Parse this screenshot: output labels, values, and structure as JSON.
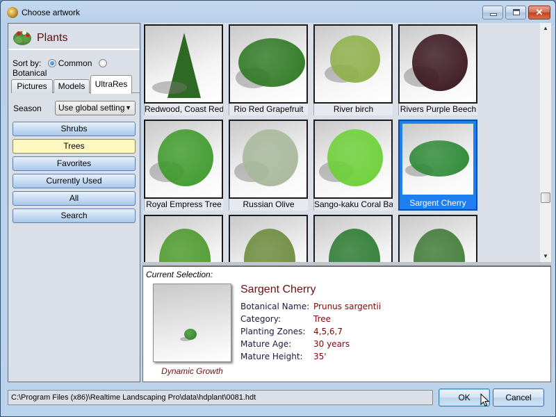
{
  "window": {
    "title": "Choose artwork",
    "controls": {
      "minimize": "minimize",
      "maximize": "maximize",
      "close": "✕"
    }
  },
  "sidebar": {
    "heading": "Plants",
    "sort_label": "Sort by:",
    "sort_options": [
      {
        "label": "Common",
        "selected": true
      },
      {
        "label": "Botanical",
        "selected": false
      }
    ],
    "tabs": [
      {
        "label": "Pictures",
        "active": false
      },
      {
        "label": "Models",
        "active": false
      },
      {
        "label": "UltraRes",
        "active": true
      }
    ],
    "season_label": "Season",
    "season_value": "Use global setting",
    "categories": [
      {
        "label": "Shrubs",
        "active": false
      },
      {
        "label": "Trees",
        "active": true
      },
      {
        "label": "Favorites",
        "active": false
      },
      {
        "label": "Currently Used",
        "active": false
      },
      {
        "label": "All",
        "active": false
      },
      {
        "label": "Search",
        "active": false
      }
    ]
  },
  "grid": {
    "items": [
      {
        "name": "Redwood, Coast Red...",
        "color": "#2f6a24",
        "shape": "cone",
        "selected": false
      },
      {
        "name": "Rio Red Grapefruit",
        "color": "#2f7a24",
        "shape": "bush",
        "selected": false
      },
      {
        "name": "River birch",
        "color": "#8fb04a",
        "shape": "airy",
        "selected": false
      },
      {
        "name": "Rivers Purple Beech",
        "color": "#3a1620",
        "shape": "round",
        "selected": false
      },
      {
        "name": "Royal Empress Tree",
        "color": "#3f9a2c",
        "shape": "round",
        "selected": false
      },
      {
        "name": "Russian Olive",
        "color": "#a8b89a",
        "shape": "round",
        "selected": false
      },
      {
        "name": "Sango-kaku Coral Ba...",
        "color": "#6cd035",
        "shape": "round",
        "selected": false
      },
      {
        "name": "Sargent Cherry",
        "color": "#2e8a36",
        "shape": "wide",
        "selected": true
      },
      {
        "name": "",
        "color": "#4a9a2a",
        "shape": "partial",
        "selected": false
      },
      {
        "name": "",
        "color": "#6a8a3a",
        "shape": "partial",
        "selected": false
      },
      {
        "name": "",
        "color": "#2a7a30",
        "shape": "partial",
        "selected": false
      },
      {
        "name": "",
        "color": "#3f7a35",
        "shape": "partial",
        "selected": false
      }
    ]
  },
  "detail": {
    "section_label": "Current Selection:",
    "preview_caption": "Dynamic Growth",
    "name": "Sargent Cherry",
    "properties": [
      {
        "key": "Botanical Name:",
        "value": "Prunus sargentii"
      },
      {
        "key": "Category:",
        "value": "Tree"
      },
      {
        "key": "Planting Zones:",
        "value": "4,5,6,7"
      },
      {
        "key": "Mature Age:",
        "value": "30 years"
      },
      {
        "key": "Mature Height:",
        "value": "35'"
      }
    ]
  },
  "footer": {
    "path": "C:\\Program Files (x86)\\Realtime Landscaping Pro\\data\\hdplant\\0081.hdt",
    "ok_label": "OK",
    "cancel_label": "Cancel"
  }
}
